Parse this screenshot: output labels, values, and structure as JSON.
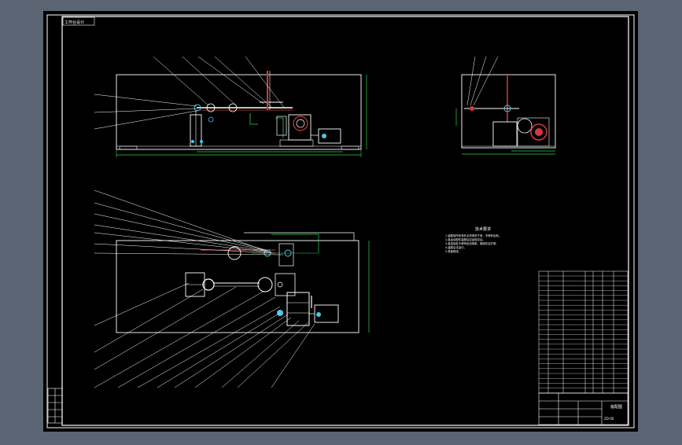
{
  "window": {
    "bg_color": "#5b6472",
    "canvas_color": "#000000",
    "frame_color": "#ffffff"
  },
  "drawing": {
    "top_left_tag": "工作台设计",
    "notes_title": "技术要求",
    "notes": [
      "1.装配前所有零件必须清洗干净，不得有毛刺。",
      "2.各运动部件装配后应运转灵活。",
      "3.各连接处不得有松动现象，紧固件应拧紧。",
      "4.装配后试运行。",
      "5.表面喷漆。"
    ],
    "title_block": {
      "name": "装配图",
      "drawing_no": "ZD-00"
    }
  }
}
